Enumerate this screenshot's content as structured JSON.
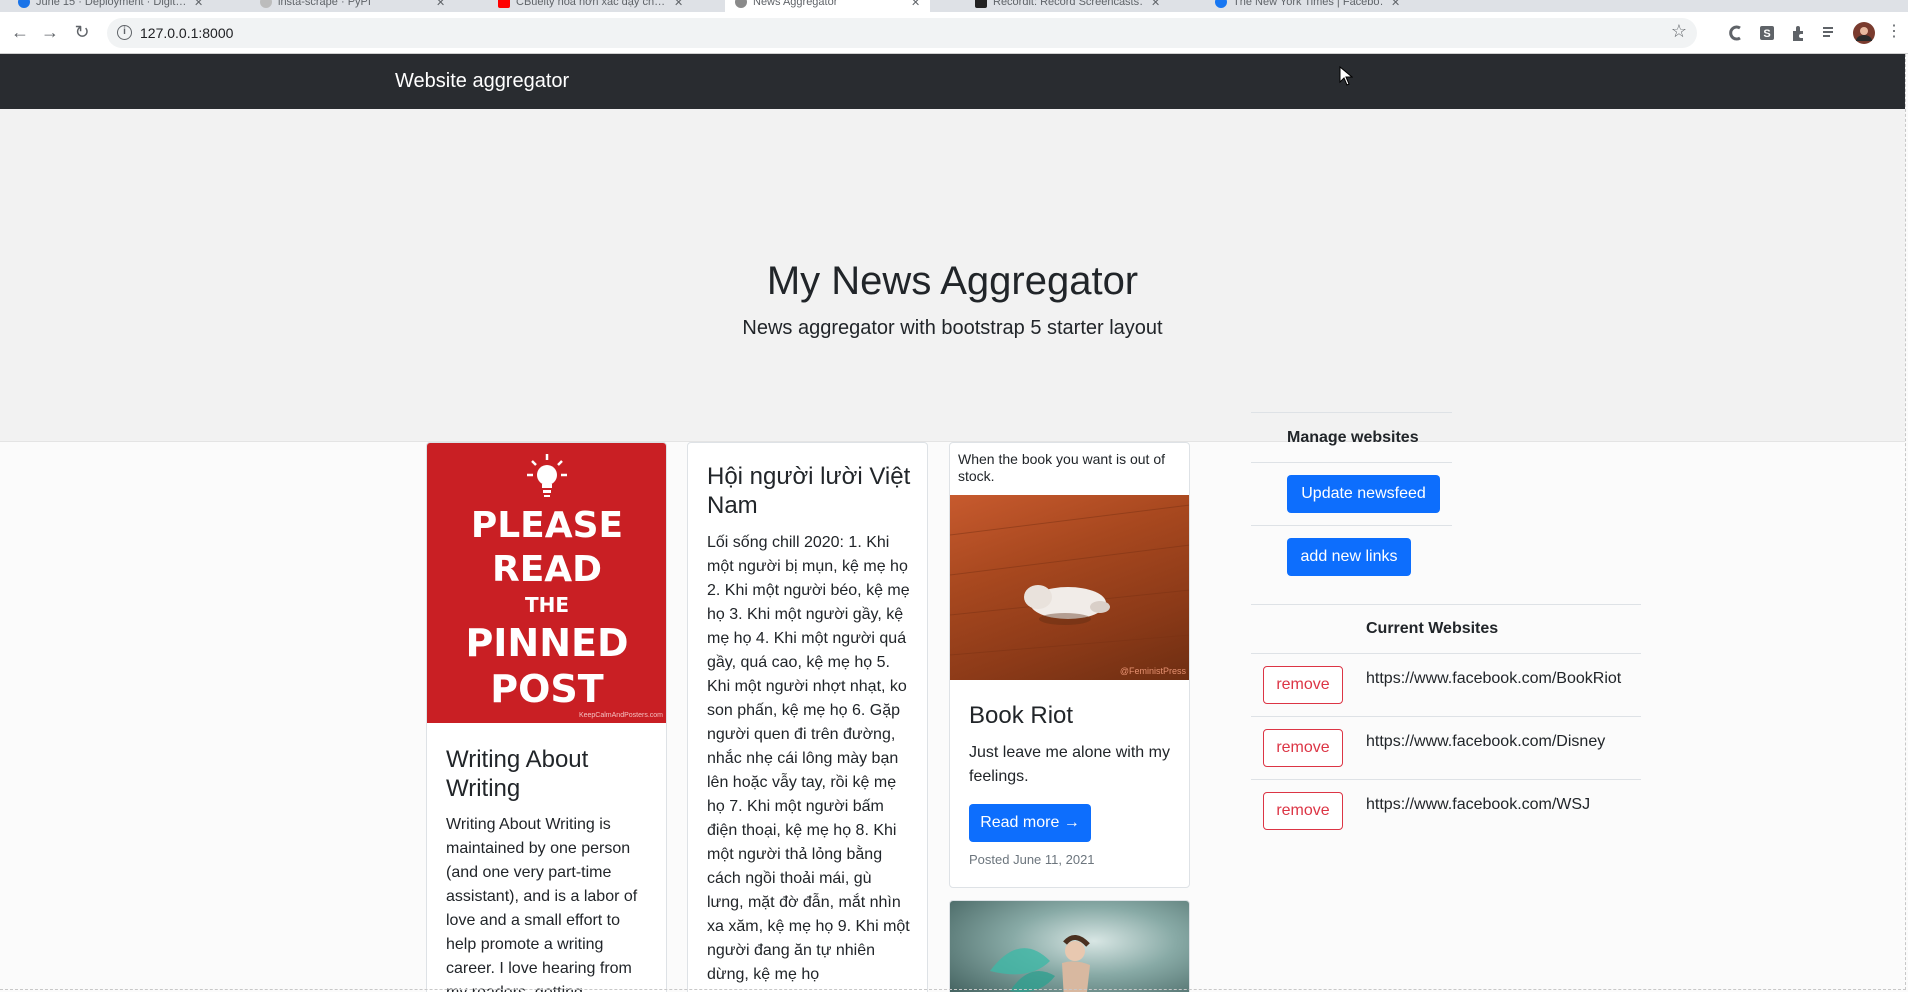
{
  "browser": {
    "tabs": [
      {
        "title": "June 15 · Deployment · Digit…",
        "color": "#1a73e8"
      },
      {
        "title": "insta-scrape · PyPI",
        "color": "#8a8a8a"
      },
      {
        "title": "CBueity hóa hơn xác dạy ch…",
        "color": "#ff0000"
      },
      {
        "title": "News Aggregator",
        "color": "#8a8a8a",
        "active": true
      },
      {
        "title": "Recordit: Record Screencasts…",
        "color": "#222222"
      },
      {
        "title": "The New York Times | Facebo…",
        "color": "#1877f2"
      }
    ],
    "url": "127.0.0.1:8000"
  },
  "navbar": {
    "brand": "Website aggregator"
  },
  "hero": {
    "title": "My News Aggregator",
    "subtitle": "News aggregator with bootstrap 5 starter layout"
  },
  "posts": [
    {
      "image_text": [
        "PLEASE",
        "READ",
        "THE",
        "PINNED",
        "POST"
      ],
      "image_footer": "KeepCalmAndPosters.com",
      "title": "Writing About Writing",
      "body": "Writing About Writing is maintained by one person (and one very part-time assistant), and is a labor of love and a small effort to help promote a writing career. I love hearing from my readers, getting"
    },
    {
      "title": "Hội người lười Việt Nam",
      "body": "Lối sống chill 2020: 1. Khi một người bị mụn, kệ mẹ họ 2. Khi một người béo, kệ mẹ họ 3. Khi một người gầy, kệ mẹ họ 4. Khi một người quá gầy, quá cao, kệ mẹ họ 5. Khi một người nhợt nhạt, ko son phấn, kệ mẹ họ 6. Gặp người quen đi trên đường, nhắc nhẹ cái lông mày bạn lên hoặc vẫy tay, rồi kệ mẹ họ 7. Khi một người bấm điện thoại, kệ mẹ họ 8. Khi một người thả lỏng bằng cách ngồi thoải mái, gù lưng, mặt đờ đẫn, mắt nhìn xa xăm, kệ mẹ họ 9. Khi một người đang ăn tự nhiên dừng, kệ mẹ họ"
    },
    {
      "caption": "When the book you want is out of stock.",
      "image_watermark": "@FeministPress",
      "title": "Book Riot",
      "body": "Just leave me alone with my feelings.",
      "button": "Read more →",
      "posted": "Posted June 11, 2021"
    }
  ],
  "sidebar": {
    "manage_heading": "Manage websites",
    "update_button": "Update newsfeed",
    "add_button": "add new links",
    "current_heading": "Current Websites",
    "remove_label": "remove",
    "websites": [
      "https://www.facebook.com/BookRiot",
      "https://www.facebook.com/Disney",
      "https://www.facebook.com/WSJ"
    ]
  },
  "colors": {
    "navbar": "#292c30",
    "primary": "#0d6efd",
    "danger": "#dc3545",
    "poster": "#c91f24"
  },
  "icons": [
    "back-arrow-icon",
    "forward-arrow-icon",
    "reload-icon",
    "info-icon",
    "star-icon",
    "extension-icon",
    "profile-avatar-icon",
    "menu-icon",
    "mouse-cursor-icon"
  ]
}
